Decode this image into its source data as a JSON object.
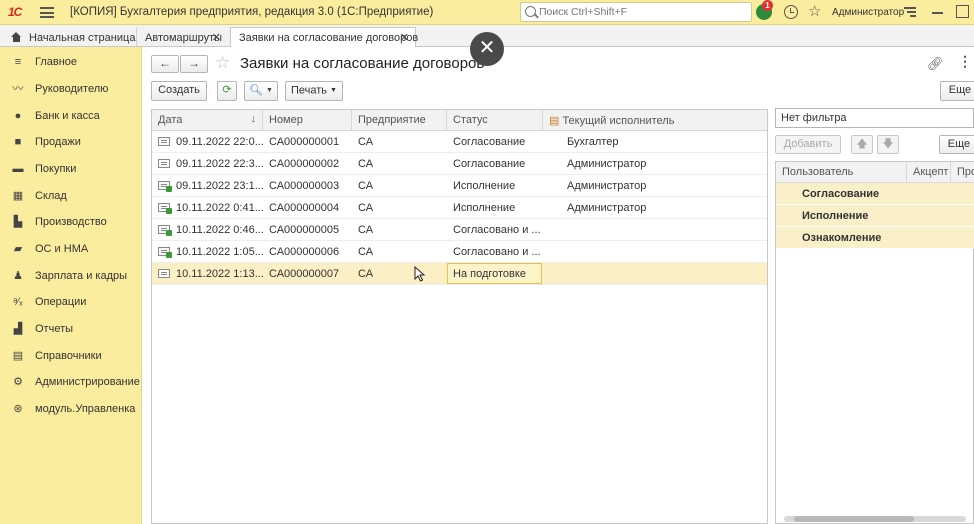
{
  "titlebar": {
    "logo": "1С",
    "title": "[КОПИЯ] Бухгалтерия предприятия, редакция 3.0  (1С:Предприятие)",
    "search_placeholder": "Поиск Ctrl+Shift+F",
    "notification_count": "1",
    "user": "Администратор"
  },
  "tabs": [
    {
      "label": "Начальная страница"
    },
    {
      "label": "Автомаршруты"
    },
    {
      "label": "Заявки на согласование договоров"
    }
  ],
  "sidebar": {
    "items": [
      {
        "label": "Главное",
        "icon": "menu-icon"
      },
      {
        "label": "Руководителю",
        "icon": "chart-line-icon"
      },
      {
        "label": "Банк и касса",
        "icon": "coin-icon"
      },
      {
        "label": "Продажи",
        "icon": "bag-icon"
      },
      {
        "label": "Покупки",
        "icon": "cart-icon"
      },
      {
        "label": "Склад",
        "icon": "warehouse-icon"
      },
      {
        "label": "Производство",
        "icon": "factory-icon"
      },
      {
        "label": "ОС и НМА",
        "icon": "truck-icon"
      },
      {
        "label": "Зарплата и кадры",
        "icon": "person-icon"
      },
      {
        "label": "Операции",
        "icon": "operations-icon"
      },
      {
        "label": "Отчеты",
        "icon": "bar-chart-icon"
      },
      {
        "label": "Справочники",
        "icon": "books-icon"
      },
      {
        "label": "Администрирование",
        "icon": "gear-icon"
      },
      {
        "label": "модуль.Управленка",
        "icon": "module-icon"
      }
    ]
  },
  "page": {
    "title": "Заявки на согласование договоров",
    "close_glyph": "✕"
  },
  "toolbar": {
    "create": "Создать",
    "print": "Печать",
    "more": "Еще"
  },
  "table": {
    "columns": [
      "Дата",
      "Номер",
      "Предприятие",
      "Статус",
      "Текущий исполнитель"
    ],
    "rows": [
      {
        "date": "09.11.2022 22:0...",
        "number": "СА000000001",
        "company": "СА",
        "status": "Согласование",
        "executor": "Бухгалтер",
        "icon": "green"
      },
      {
        "date": "09.11.2022 22:3...",
        "number": "СА000000002",
        "company": "СА",
        "status": "Согласование",
        "executor": "Администратор",
        "icon": "plain"
      },
      {
        "date": "09.11.2022 23:1...",
        "number": "СА000000003",
        "company": "СА",
        "status": "Исполнение",
        "executor": "Администратор",
        "icon": "green"
      },
      {
        "date": "10.11.2022 0:41...",
        "number": "СА000000004",
        "company": "СА",
        "status": "Исполнение",
        "executor": "Администратор",
        "icon": "green"
      },
      {
        "date": "10.11.2022 0:46...",
        "number": "СА000000005",
        "company": "СА",
        "status": "Согласовано и ...",
        "executor": "",
        "icon": "green"
      },
      {
        "date": "10.11.2022 1:05...",
        "number": "СА000000006",
        "company": "СА",
        "status": "Согласовано и ...",
        "executor": "",
        "icon": "green"
      },
      {
        "date": "10.11.2022 1:13...",
        "number": "СА000000007",
        "company": "СА",
        "status": "На подготовке",
        "executor": "",
        "icon": "plain",
        "selected": true
      }
    ]
  },
  "right_panel": {
    "filter": "Нет фильтра",
    "add": "Добавить",
    "more": "Еще",
    "columns": [
      "Пользователь",
      "Акцепт",
      "Про"
    ],
    "groups": [
      "Согласование",
      "Исполнение",
      "Ознакомление"
    ]
  },
  "colors": {
    "sidebar_bg": "#fbed9e",
    "selection": "#fbefc5",
    "accent_green": "#3a9a3a"
  }
}
